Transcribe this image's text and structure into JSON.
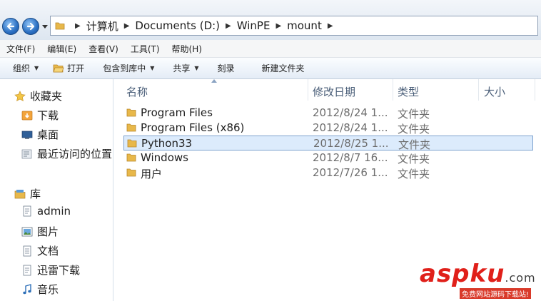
{
  "address": {
    "crumbs": [
      "计算机",
      "Documents (D:)",
      "WinPE",
      "mount"
    ]
  },
  "menu": [
    "文件(F)",
    "编辑(E)",
    "查看(V)",
    "工具(T)",
    "帮助(H)"
  ],
  "commands": {
    "organize": "组织",
    "open": "打开",
    "include_in_library": "包含到库中",
    "share": "共享",
    "burn": "刻录",
    "new_folder": "新建文件夹"
  },
  "nav": {
    "favorites": "收藏夹",
    "downloads": "下载",
    "desktop": "桌面",
    "recent": "最近访问的位置",
    "libraries": "库",
    "admin": "admin",
    "pictures": "图片",
    "documents": "文档",
    "xunlei": "迅雷下载",
    "music": "音乐"
  },
  "columns": {
    "name": "名称",
    "modified": "修改日期",
    "type": "类型",
    "size": "大小"
  },
  "files": [
    {
      "name": "Program Files",
      "modified": "2012/8/24 1...",
      "type": "文件夹",
      "selected": false
    },
    {
      "name": "Program Files (x86)",
      "modified": "2012/8/24 1...",
      "type": "文件夹",
      "selected": false
    },
    {
      "name": "Python33",
      "modified": "2012/8/25 1...",
      "type": "文件夹",
      "selected": true
    },
    {
      "name": "Windows",
      "modified": "2012/8/7 16...",
      "type": "文件夹",
      "selected": false
    },
    {
      "name": "用户",
      "modified": "2012/7/26 1...",
      "type": "文件夹",
      "selected": false
    }
  ],
  "watermark": {
    "brand_a": "asp",
    "brand_b": "ku",
    "brand_c": ".com",
    "sub": "免费网站源码下载站!"
  },
  "colors": {
    "selection": "#dcebfc",
    "folder": "#e8b84a"
  }
}
